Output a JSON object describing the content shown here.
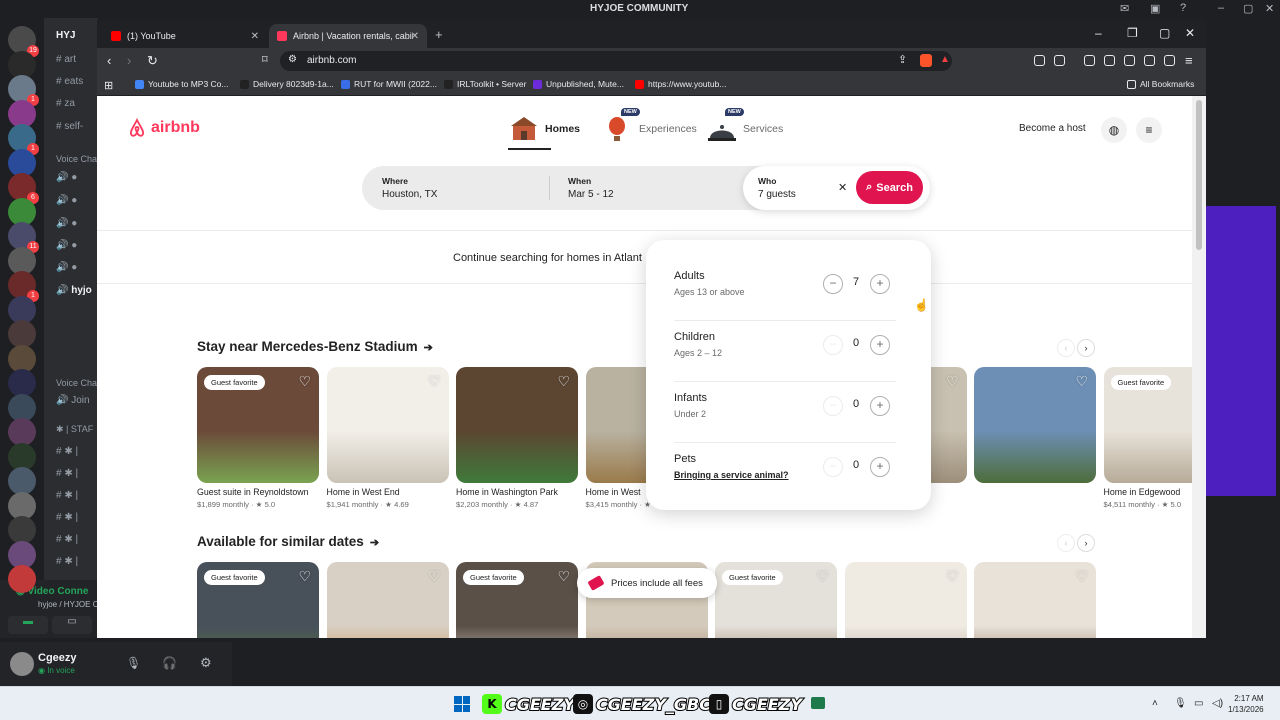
{
  "discord": {
    "title": "HYJOE COMMUNITY",
    "channels": [
      "art",
      "eats",
      "za",
      "self-"
    ],
    "voice_header": "Voice Cha",
    "join_label": "Join",
    "staff_label": "STAF",
    "voice_connected": "Video Conne",
    "voice_sub": "hyjoe / HYJOE C",
    "user_name": "Cgeezy",
    "user_status": "In voice",
    "server_badges": [
      "19",
      "1",
      "1",
      "6",
      "11",
      "1",
      "3",
      "3",
      "1",
      "1",
      "1",
      "NEW"
    ],
    "server_label": "HYJ",
    "hyjoe_item": "hyjo"
  },
  "browser": {
    "tabs": [
      {
        "label": "(1) YouTube",
        "active": false,
        "color": "#ff0000"
      },
      {
        "label": "Airbnb | Vacation rentals, cabins...",
        "active": true,
        "color": "#ff385c"
      }
    ],
    "url": "airbnb.com",
    "bookmarks": [
      {
        "label": "Youtube to MP3 Co...",
        "color": "#4285f4"
      },
      {
        "label": "Delivery 8023d9-1a...",
        "color": "#222222"
      },
      {
        "label": "RUT for MWII (2022...",
        "color": "#3a6ee8"
      },
      {
        "label": "IRLToolkit • Server",
        "color": "#222222"
      },
      {
        "label": "Unpublished, Mute...",
        "color": "#6c2bd9"
      },
      {
        "label": "https://www.youtub...",
        "color": "#ff0000"
      }
    ],
    "all_bookmarks": "All Bookmarks"
  },
  "airbnb": {
    "logo_text": "airbnb",
    "nav": [
      {
        "label": "Homes",
        "active": true,
        "badge": ""
      },
      {
        "label": "Experiences",
        "active": false,
        "badge": "NEW"
      },
      {
        "label": "Services",
        "active": false,
        "badge": "NEW"
      }
    ],
    "become_host": "Become a host",
    "search": {
      "where_label": "Where",
      "where_value": "Houston, TX",
      "when_label": "When",
      "when_value": "Mar 5 - 12",
      "who_label": "Who",
      "who_value": "7 guests",
      "button": "Search"
    },
    "continue_text": "Continue searching for homes in Atlant",
    "section1": {
      "title": "Stay near Mercedes-Benz Stadium",
      "cards": [
        {
          "title": "Guest suite in Reynoldstown",
          "price": "$1,899 monthly",
          "rating": "★ 5.0",
          "badge": "Guest favorite",
          "c1": "#6b4a3a",
          "c2": "#7aa350"
        },
        {
          "title": "Home in West End",
          "price": "$1,941 monthly",
          "rating": "★ 4.69",
          "badge": "",
          "c1": "#f2efe9",
          "c2": "#c9c2b5"
        },
        {
          "title": "Home in Washington Park",
          "price": "$2,203 monthly",
          "rating": "★ 4.87",
          "badge": "",
          "c1": "#5c4632",
          "c2": "#3f7a3a"
        },
        {
          "title": "Home in West",
          "price": "$3,415 monthly",
          "rating": "★ 4.9",
          "badge": "",
          "c1": "#b9b2a1",
          "c2": "#9a7a4a"
        },
        {
          "title": "",
          "price": "",
          "rating": "",
          "badge": "",
          "c1": "#8fa3b8",
          "c2": "#5b7a4a"
        },
        {
          "title": "",
          "price": "",
          "rating": "",
          "badge": "",
          "c1": "#c8c0b0",
          "c2": "#9d8f7a"
        },
        {
          "title": "",
          "price": "",
          "rating": "",
          "badge": "",
          "c1": "#6d8fb5",
          "c2": "#4d6d3a"
        },
        {
          "title": "Home in Edgewood",
          "price": "$4,511 monthly",
          "rating": "★ 5.0",
          "badge": "Guest favorite",
          "c1": "#e8e3da",
          "c2": "#b7aa98"
        }
      ]
    },
    "section2": {
      "title": "Available for similar dates",
      "cards": [
        {
          "badge": "Guest favorite",
          "c1": "#48505a",
          "c2": "#4f7a3a"
        },
        {
          "badge": "",
          "c1": "#d8d0c4",
          "c2": "#c98a3a"
        },
        {
          "badge": "Guest favorite",
          "c1": "#5a5048",
          "c2": "#e8e0d4"
        },
        {
          "badge": "",
          "c1": "#d4cabb",
          "c2": "#9c7a5e"
        },
        {
          "badge": "Guest favorite",
          "c1": "#e4e0da",
          "c2": "#8a6a4a"
        },
        {
          "badge": "",
          "c1": "#efeae2",
          "c2": "#b0a698"
        },
        {
          "badge": "",
          "c1": "#e8e2d8",
          "c2": "#7a6048"
        }
      ]
    },
    "prices_pill": "Prices include all fees",
    "guests": [
      {
        "name": "Adults",
        "sub": "Ages 13 or above",
        "count": "7",
        "minus_enabled": true,
        "link": false
      },
      {
        "name": "Children",
        "sub": "Ages 2 – 12",
        "count": "0",
        "minus_enabled": false,
        "link": false
      },
      {
        "name": "Infants",
        "sub": "Under 2",
        "count": "0",
        "minus_enabled": false,
        "link": false
      },
      {
        "name": "Pets",
        "sub": "Bringing a service animal?",
        "count": "0",
        "minus_enabled": false,
        "link": true
      }
    ]
  },
  "taskbar": {
    "social_k": "CGEEZY",
    "social_ig": "CGEEZY_GBC",
    "social_tw": "CGEEZY",
    "time": "2:17 AM",
    "date": "1/13/2026"
  },
  "colors": {
    "airbnb_red": "#ff385c",
    "search_btn": "#e0144f",
    "discord_bg": "#1e1f22"
  }
}
